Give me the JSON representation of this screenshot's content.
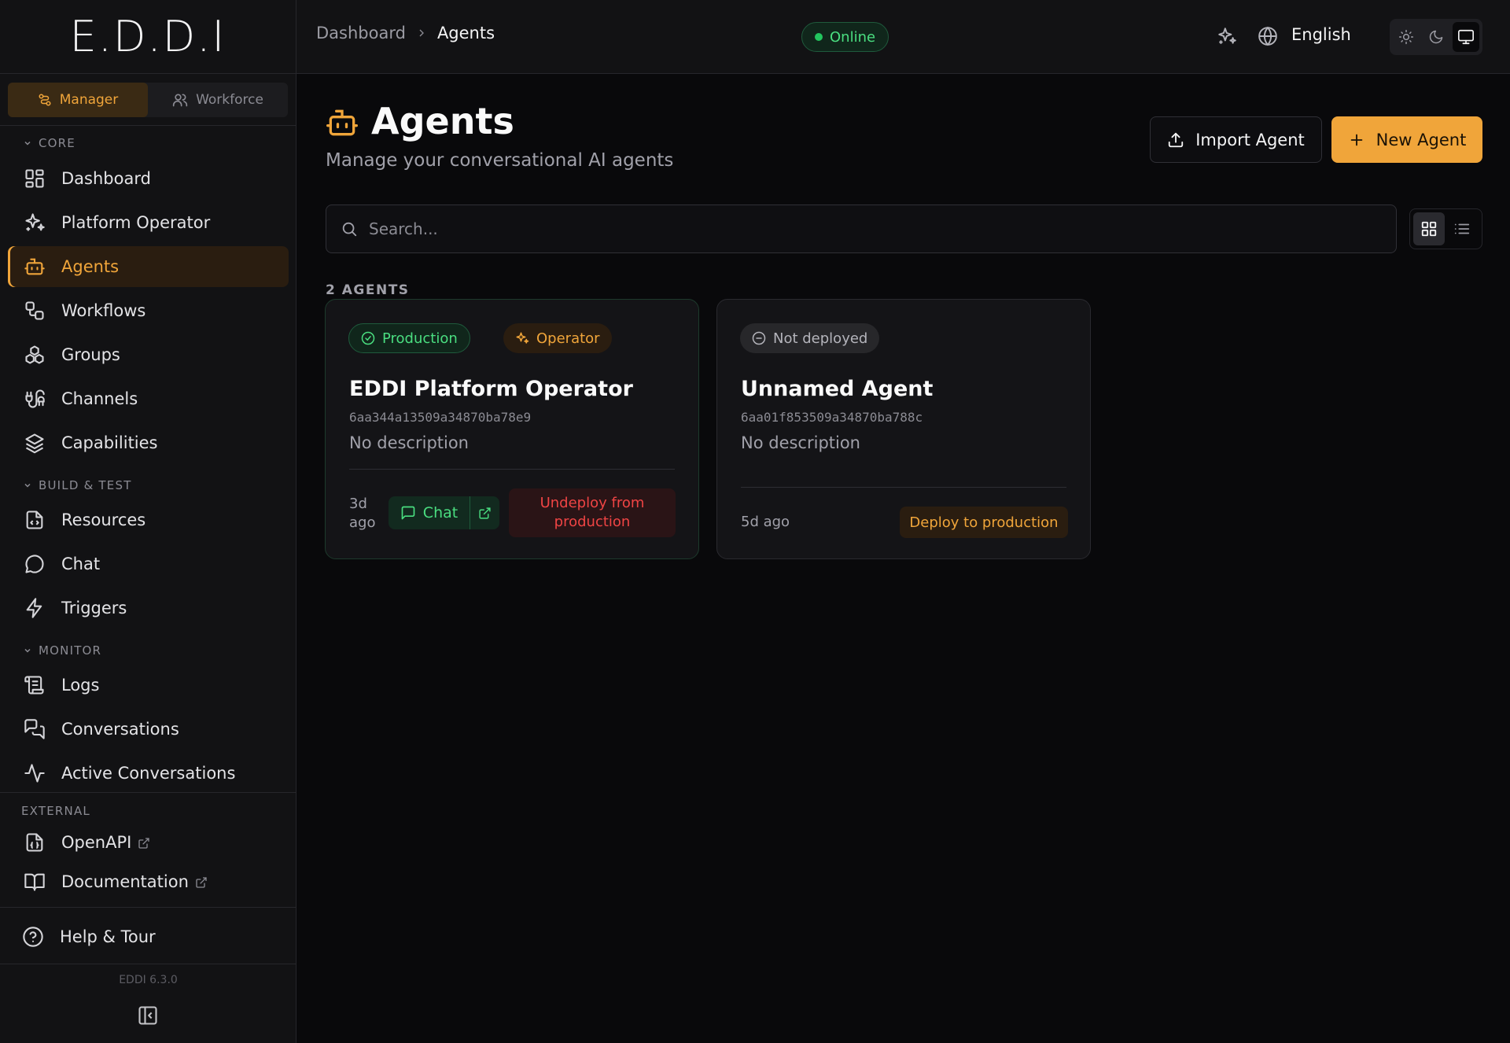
{
  "app": {
    "logo": "E.D.D.I",
    "version": "EDDI 6.3.0"
  },
  "switcher": {
    "manager": "Manager",
    "workforce": "Workforce"
  },
  "sidebar": {
    "sections": {
      "core": "CORE",
      "build": "BUILD & TEST",
      "monitor": "MONITOR",
      "external": "EXTERNAL"
    },
    "items": {
      "dashboard": "Dashboard",
      "platform_operator": "Platform Operator",
      "agents": "Agents",
      "workflows": "Workflows",
      "groups": "Groups",
      "channels": "Channels",
      "capabilities": "Capabilities",
      "resources": "Resources",
      "chat": "Chat",
      "triggers": "Triggers",
      "logs": "Logs",
      "conversations": "Conversations",
      "active_conversations": "Active Conversations",
      "openapi": "OpenAPI",
      "documentation": "Documentation",
      "help": "Help & Tour"
    }
  },
  "topbar": {
    "breadcrumb": [
      "Dashboard",
      "Agents"
    ],
    "status": "Online",
    "language": "English"
  },
  "page": {
    "title": "Agents",
    "subtitle": "Manage your conversational AI agents",
    "import_label": "Import Agent",
    "new_label": "New Agent",
    "search_placeholder": "Search...",
    "count": "2 AGENTS"
  },
  "agents": [
    {
      "badge": "Production",
      "tag": "Operator",
      "name": "EDDI Platform Operator",
      "id": "6aa344a13509a34870ba78e9",
      "description": "No description",
      "age_line1": "3d",
      "age_line2": "ago",
      "chat_label": "Chat",
      "action": "Undeploy from production"
    },
    {
      "badge": "Not deployed",
      "name": "Unnamed Agent",
      "id": "6aa01f853509a34870ba788c",
      "description": "No description",
      "age": "5d ago",
      "action": "Deploy to production"
    }
  ],
  "colors": {
    "accent": "#f0a53a",
    "success": "#4ade80",
    "danger": "#ef4444",
    "background": "#09090b",
    "panel": "#121214"
  }
}
